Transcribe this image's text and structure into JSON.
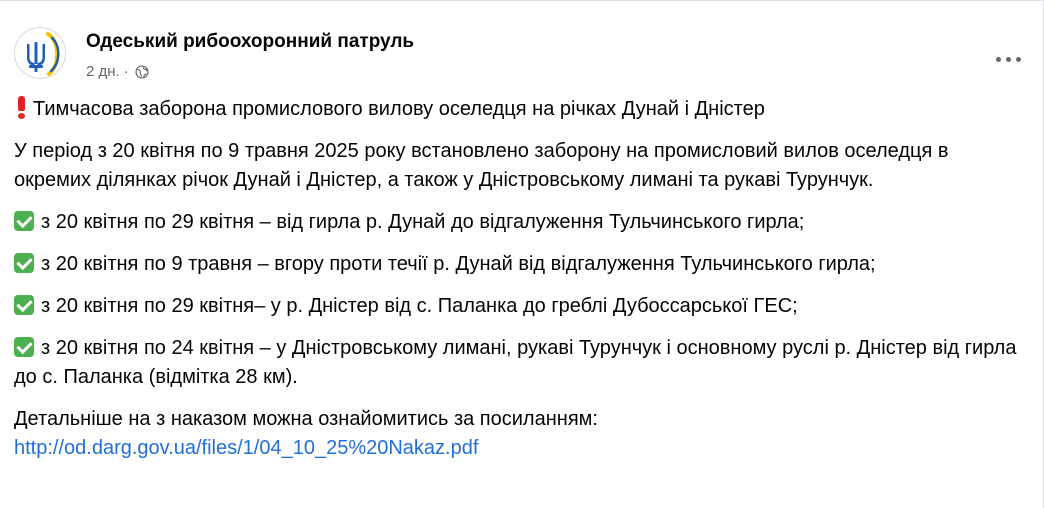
{
  "post": {
    "page_name": "Одеський рибоохоронний патруль",
    "time": "2 дн.",
    "separator": "·",
    "audience_icon": "globe-icon",
    "more_icon": "more-options-icon",
    "colors": {
      "link": "#216fdb",
      "secondary": "#65676b",
      "check": "#4caf50",
      "exclamation": "#e02424"
    }
  },
  "content": {
    "headline": "Тимчасова заборона промислового вилову оселедця на річках Дунай і Дністер",
    "intro": "У період з 20 квітня по 9 травня 2025 року встановлено заборону на промисловий вилов оселедця в окремих ділянках річок Дунай і Дністер, а також у Дністровському лимані та рукаві Турунчук.",
    "items": [
      "з 20 квітня по 29 квітня – від гирла р. Дунай до відгалуження Тульчинського гирла;",
      "з 20 квітня по 9 травня – вгору проти течії р. Дунай від відгалуження Тульчинського гирла;",
      "з 20 квітня по 29 квітня– у р. Дністер від с. Паланка до греблі Дубоссарської ГЕС;",
      "з 20 квітня по 24 квітня – у Дністровському лимані, рукаві Турунчук і основному руслі р. Дністер від гирла до с. Паланка (відмітка 28 км)."
    ],
    "details": "Детальніше на  з наказом можна ознайомитись за посиланням:",
    "link": "http://od.darg.gov.ua/files/1/04_10_25%20Nakaz.pdf"
  }
}
